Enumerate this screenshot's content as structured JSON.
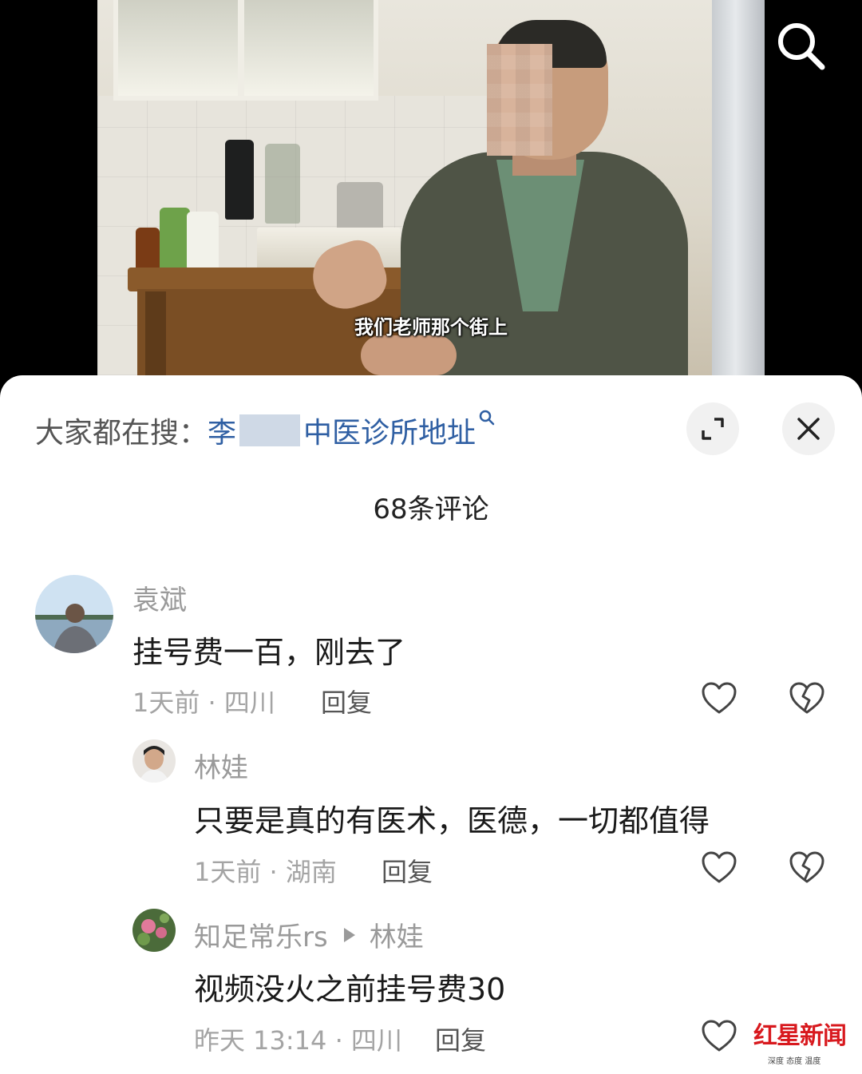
{
  "video": {
    "subtitle": "我们老师那个街上",
    "search_icon": "search-icon"
  },
  "sheet": {
    "hot_search_prefix": "大家都在搜：",
    "hot_search_name": "李",
    "hot_search_query": "中医诊所地址",
    "expand_icon": "expand-icon",
    "close_icon": "close-icon",
    "comment_count": "68条评论"
  },
  "comments": [
    {
      "author": "袁斌",
      "content": "挂号费一百，刚去了",
      "meta": "1天前 · 四川",
      "reply_label": "回复"
    },
    {
      "author": "林娃",
      "content": "只要是真的有医术，医德，一切都值得",
      "meta": "1天前 · 湖南",
      "reply_label": "回复"
    },
    {
      "author": "知足常乐rs",
      "reply_to": "林娃",
      "content": "视频没火之前挂号费30",
      "meta": "昨天 13:14 · 四川",
      "reply_label": "回复"
    }
  ],
  "watermark": {
    "main": "红星新闻",
    "sub": "深度 态度 温度"
  },
  "colors": {
    "link_blue": "#2f5fa3",
    "watermark_red": "#d8191e"
  }
}
